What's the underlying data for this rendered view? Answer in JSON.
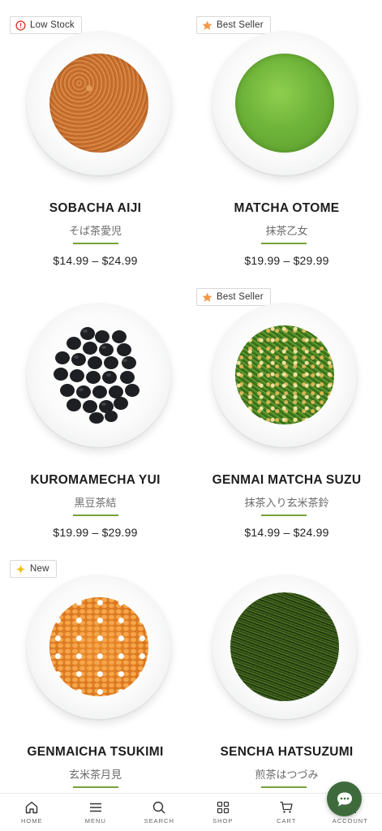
{
  "products": [
    {
      "name": "SOBACHA AIJI",
      "jp": "そば茶愛児",
      "price": "$14.99 – $24.99",
      "badge": {
        "label": "Low Stock",
        "icon": "alert-circle-icon",
        "color": "#d93a2b"
      },
      "tea": "sobacha"
    },
    {
      "name": "MATCHA OTOME",
      "jp": "抹茶乙女",
      "price": "$19.99 – $29.99",
      "badge": {
        "label": "Best Seller",
        "icon": "star-icon",
        "color": "#f2994a"
      },
      "tea": "matcha"
    },
    {
      "name": "KUROMAMECHA YUI",
      "jp": "黒豆茶結",
      "price": "$19.99 – $29.99",
      "badge": null,
      "tea": "kuromame"
    },
    {
      "name": "GENMAI MATCHA SUZU",
      "jp": "抹茶入り玄米茶鈴",
      "price": "$14.99 – $24.99",
      "badge": {
        "label": "Best Seller",
        "icon": "star-icon",
        "color": "#f2994a"
      },
      "tea": "genmaimatcha"
    },
    {
      "name": "GENMAICHA TSUKIMI",
      "jp": "玄米茶月見",
      "price": "",
      "badge": {
        "label": "New",
        "icon": "sparkle-icon",
        "color": "#f2c018"
      },
      "tea": "genmaicha"
    },
    {
      "name": "SENCHA HATSUZUMI",
      "jp": "煎茶はつづみ",
      "price": "",
      "badge": null,
      "tea": "sencha"
    }
  ],
  "nav": [
    {
      "label": "HOME",
      "icon": "home-icon"
    },
    {
      "label": "MENU",
      "icon": "menu-icon"
    },
    {
      "label": "SEARCH",
      "icon": "search-icon"
    },
    {
      "label": "SHOP",
      "icon": "grid-icon"
    },
    {
      "label": "CART",
      "icon": "cart-icon"
    },
    {
      "label": "ACCOUNT",
      "icon": "account-icon"
    }
  ],
  "colors": {
    "accent_rule": "#77a23a",
    "chat_button": "#3f6b3c"
  }
}
